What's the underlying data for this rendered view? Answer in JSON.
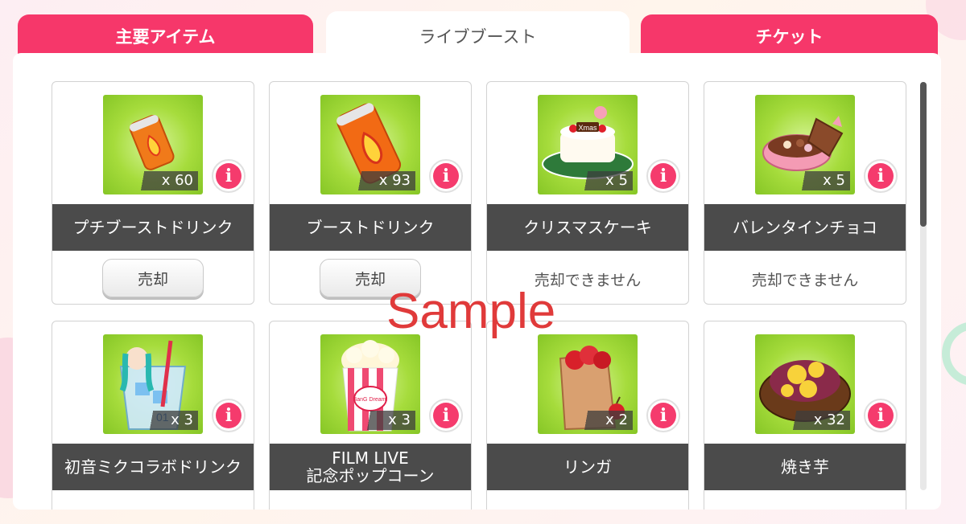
{
  "tabs": [
    {
      "label": "主要アイテム",
      "active": false
    },
    {
      "label": "ライブブースト",
      "active": true
    },
    {
      "label": "チケット",
      "active": false
    }
  ],
  "items": [
    {
      "name": "プチブーストドリンク",
      "qty": "x 60",
      "sell_label": "売却",
      "icon": "small-boost-drink-can-icon"
    },
    {
      "name": "ブーストドリンク",
      "qty": "x 93",
      "sell_label": "売却",
      "icon": "boost-drink-can-icon"
    },
    {
      "name": "クリスマスケーキ",
      "qty": "x 5",
      "status": "売却できません",
      "icon": "christmas-cake-icon",
      "cake_text": "Xmas"
    },
    {
      "name": "バレンタインチョコ",
      "qty": "x 5",
      "status": "売却できません",
      "icon": "valentine-chocolate-box-icon"
    },
    {
      "name": "初音ミクコラボドリンク",
      "qty": "x 3",
      "icon": "miku-collab-drink-icon",
      "cup_text": "01"
    },
    {
      "name_line1": "FILM LIVE",
      "name_line2": "記念ポップコーン",
      "qty": "x 3",
      "icon": "popcorn-icon",
      "bag_text": "BanG Dream!"
    },
    {
      "name": "リンガ",
      "qty": "x 2",
      "icon": "apple-bag-icon"
    },
    {
      "name": "焼き芋",
      "qty": "x 32",
      "icon": "sweet-potato-icon"
    }
  ],
  "info_label": "i",
  "watermark": "Sample",
  "colors": {
    "accent": "#f6376a",
    "item_bg": "#a6dc3c",
    "name_bar": "#4b4b4b"
  }
}
